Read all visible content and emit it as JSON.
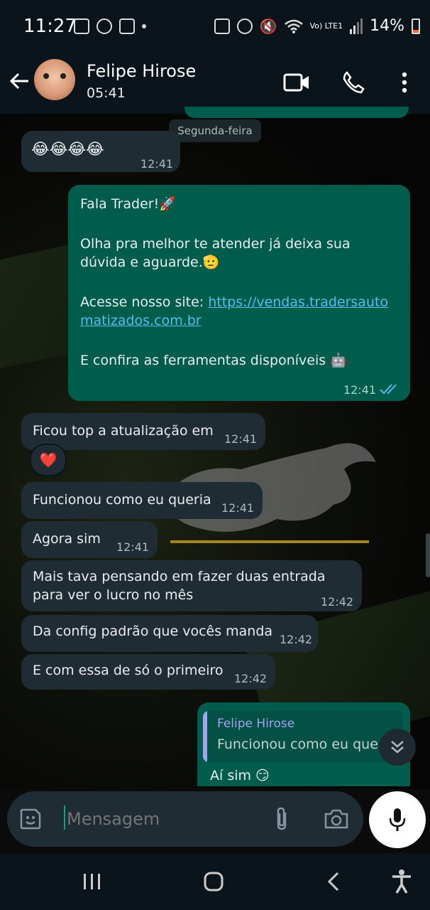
{
  "status_bar": {
    "time": "11:27",
    "network": "Vo) LTE1",
    "battery": "14%"
  },
  "header": {
    "contact_name": "Felipe Hirose",
    "last_seen": "05:41"
  },
  "chat": {
    "date_chip": "Segunda-feira",
    "messages": [
      {
        "dir": "in",
        "text": "😂😂😂😂",
        "time": "12:41"
      },
      {
        "dir": "out",
        "lines": {
          "greeting": "Fala Trader!🚀",
          "ask": "Olha pra melhor te atender já deixa sua dúvida e aguarde.🫡",
          "site_label": "Acesse nosso site: ",
          "site_link": "https://vendas.tradersautomatizados.com.br",
          "tools": "E confira as ferramentas disponíveis 🤖"
        },
        "time": "12:41"
      },
      {
        "dir": "in",
        "text": "Ficou top a atualização em",
        "time": "12:41",
        "reaction": "❤️"
      },
      {
        "dir": "in",
        "text": "Funcionou como eu queria",
        "time": "12:41"
      },
      {
        "dir": "in",
        "text": "Agora sim",
        "time": "12:41"
      },
      {
        "dir": "in",
        "text": "Mais tava pensando em fazer duas entrada para ver o lucro no mês",
        "time": "12:42"
      },
      {
        "dir": "in",
        "text": "Da config padrão que vocês manda",
        "time": "12:42"
      },
      {
        "dir": "in",
        "text": "E com essa de só o primeiro",
        "time": "12:42"
      },
      {
        "dir": "out",
        "quote_author": "Felipe Hirose",
        "quote_text": "Funcionou como eu que",
        "text": "Aí sim 😏"
      }
    ]
  },
  "input": {
    "placeholder": "Mensagem"
  },
  "colors": {
    "incoming": "#202c33",
    "outgoing": "#005c4b",
    "link": "#53bdeb",
    "read_ticks": "#53bdeb"
  }
}
